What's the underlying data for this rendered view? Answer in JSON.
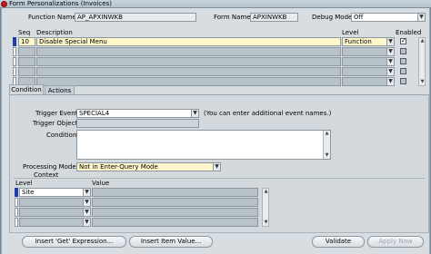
{
  "window": {
    "title": "Form Personalizations (Invoices)"
  },
  "header": {
    "function_name_label": "Function Name",
    "function_name_value": "AP_APXINWKB",
    "form_name_label": "Form Name",
    "form_name_value": "APXINWKB",
    "debug_mode_label": "Debug Mode",
    "debug_mode_value": "Off"
  },
  "rules": {
    "headers": {
      "seq": "Seq",
      "description": "Description",
      "level": "Level",
      "enabled": "Enabled"
    },
    "rows": [
      {
        "seq": "10",
        "description": "Disable Special Menu",
        "level": "Function",
        "enabled": "✓"
      },
      {
        "seq": "",
        "description": "",
        "level": "",
        "enabled": ""
      },
      {
        "seq": "",
        "description": "",
        "level": "",
        "enabled": ""
      },
      {
        "seq": "",
        "description": "",
        "level": "",
        "enabled": ""
      },
      {
        "seq": "",
        "description": "",
        "level": "",
        "enabled": ""
      }
    ]
  },
  "tabs": [
    {
      "label": "Condition"
    },
    {
      "label": "Actions"
    }
  ],
  "condition": {
    "trigger_event_label": "Trigger Event",
    "trigger_event_value": "SPECIAL4",
    "trigger_event_hint": "(You can enter additional event names.)",
    "trigger_object_label": "Trigger Object",
    "trigger_object_value": "",
    "condition_label": "Condition",
    "condition_value": "",
    "processing_mode_label": "Processing Mode",
    "processing_mode_value": "Not in Enter-Query Mode"
  },
  "context": {
    "section_label": "Context",
    "headers": {
      "level": "Level",
      "value": "Value"
    },
    "rows": [
      {
        "level": "Site",
        "value": ""
      },
      {
        "level": "",
        "value": ""
      },
      {
        "level": "",
        "value": ""
      },
      {
        "level": "",
        "value": ""
      }
    ]
  },
  "buttons": {
    "insert_get_expression": "Insert 'Get' Expression...",
    "insert_item_value": "Insert Item Value...",
    "validate": "Validate",
    "apply_now": "Apply Now"
  },
  "icons": {
    "app_logo": "oracle-logo-icon",
    "dropdown": "chevron-down-icon",
    "scroll": "scrollbar"
  },
  "colors": {
    "highlight_row": "#fff7cc",
    "current_record": "#1f3fa6",
    "logo": "#c21c1c"
  }
}
